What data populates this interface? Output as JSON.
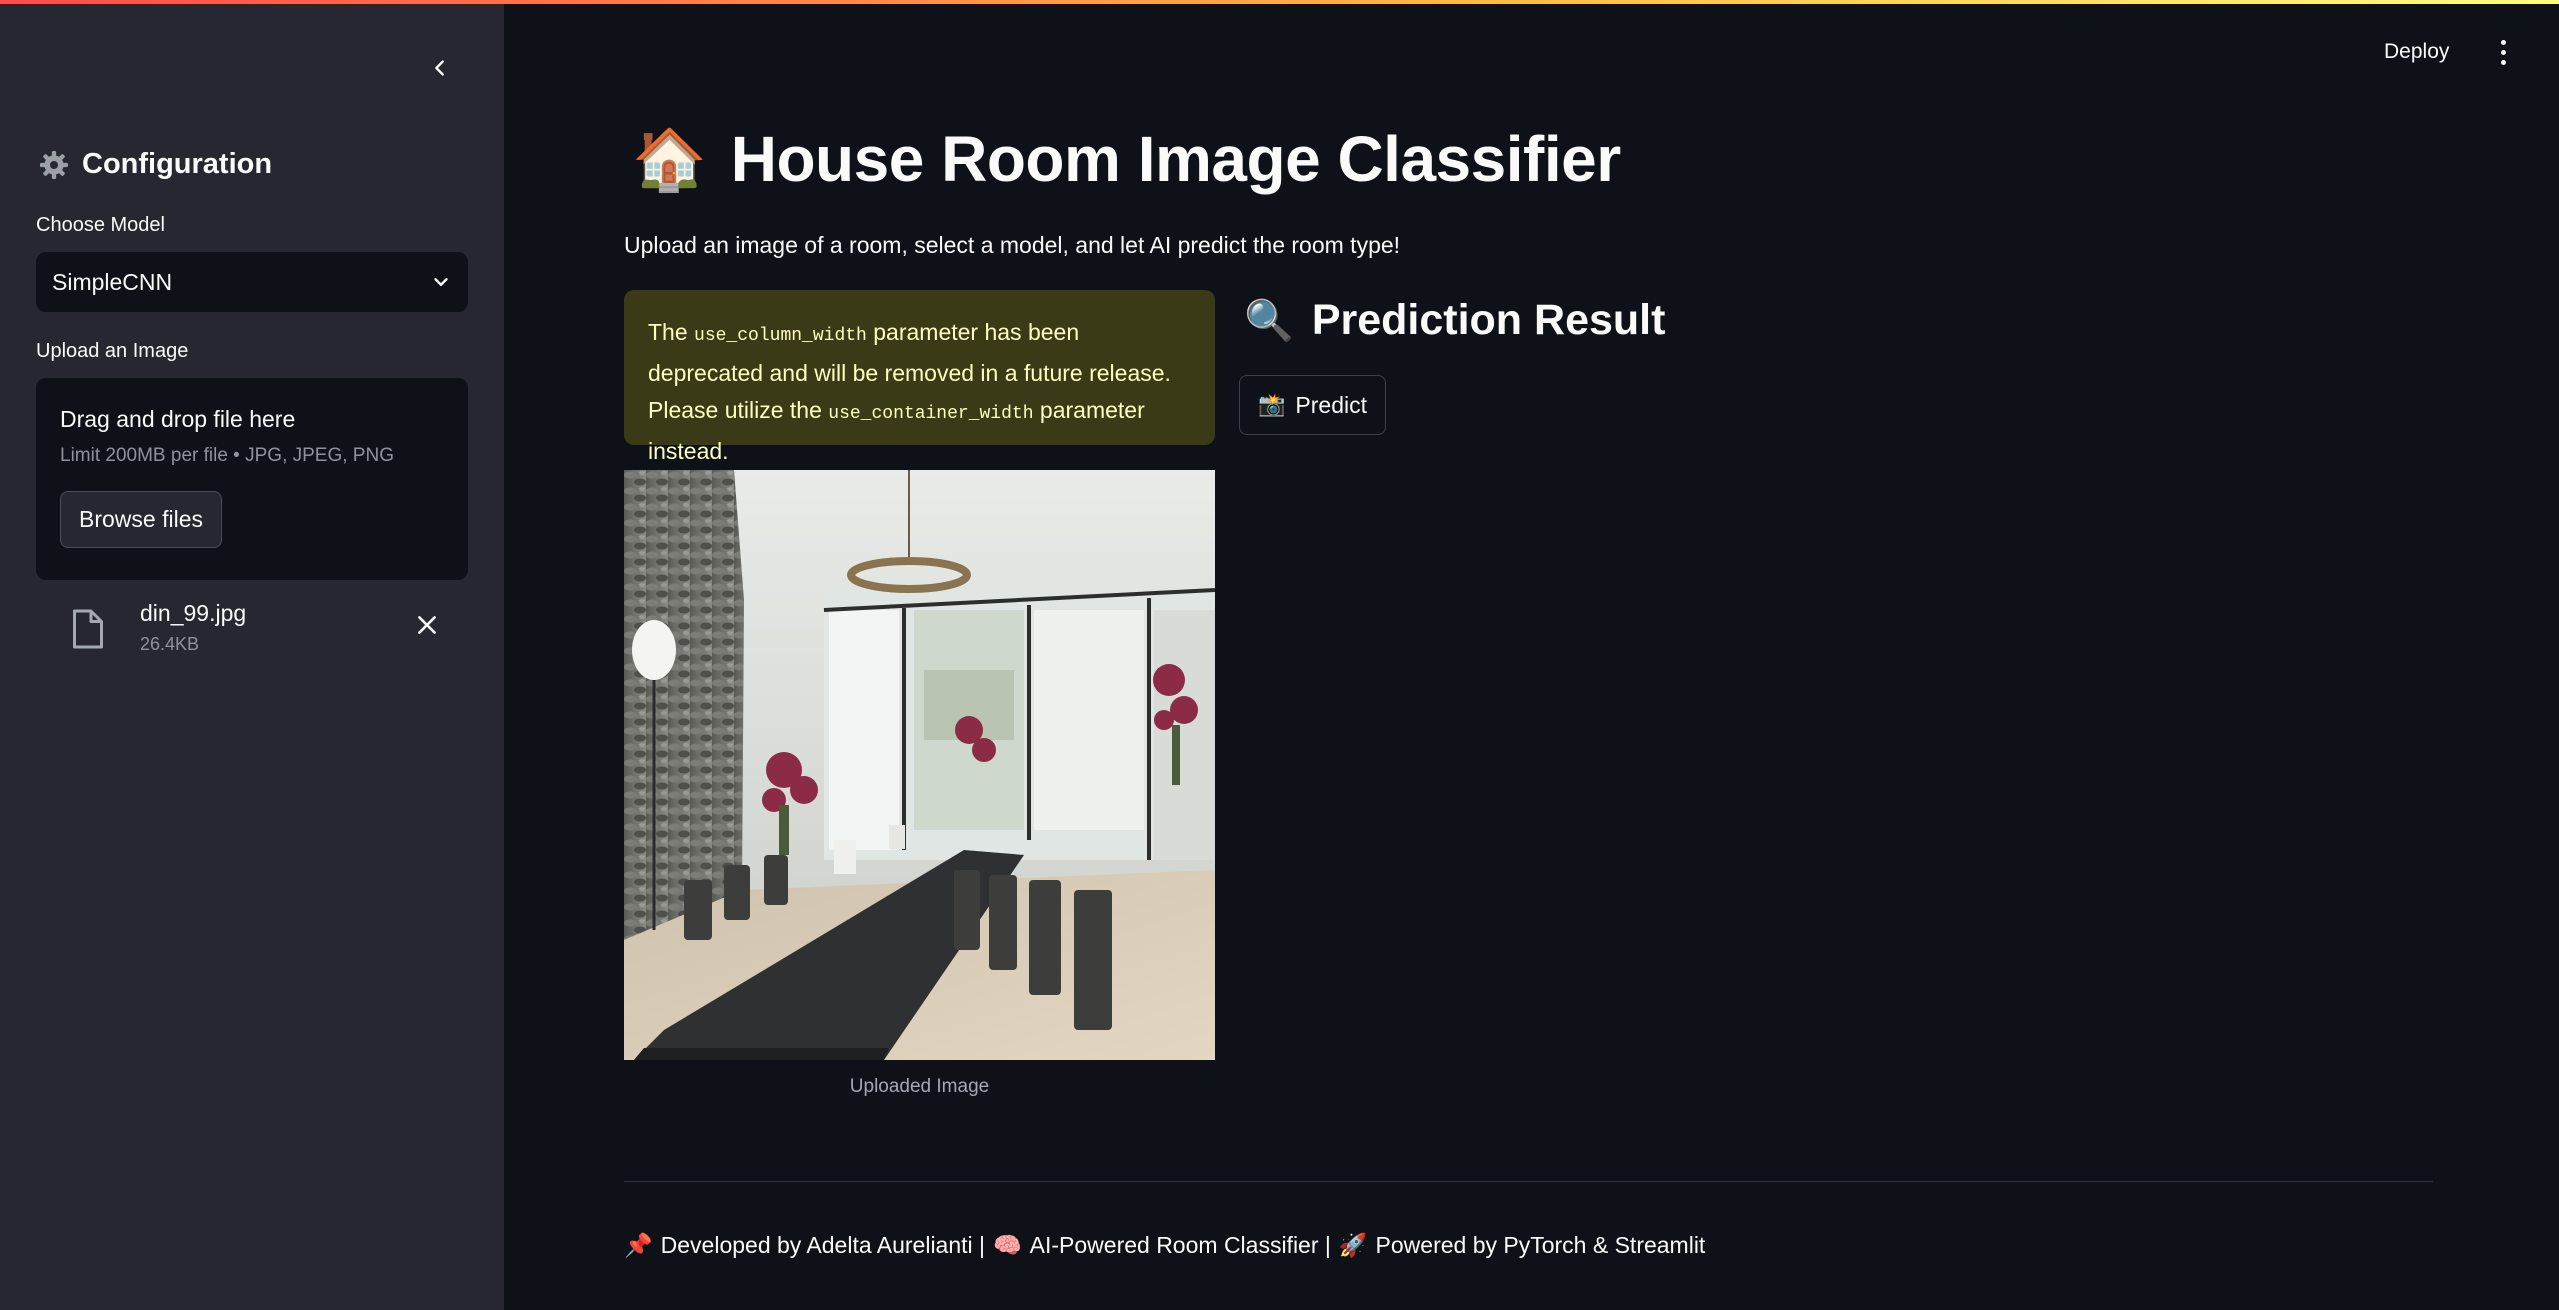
{
  "sidebar": {
    "title": "Configuration",
    "title_icon": "gear-icon",
    "model_label": "Choose Model",
    "model_selected": "SimpleCNN",
    "upload_label": "Upload an Image",
    "dropzone_title": "Drag and drop file here",
    "dropzone_limit": "Limit 200MB per file • JPG, JPEG, PNG",
    "browse_label": "Browse files",
    "file": {
      "name": "din_99.jpg",
      "size": "26.4KB"
    }
  },
  "header": {
    "deploy_label": "Deploy"
  },
  "main": {
    "title_emoji": "🏠",
    "title": "House Room Image Classifier",
    "subtitle": "Upload an image of a room, select a model, and let AI predict the room type!",
    "warning": {
      "part1": "The ",
      "code1": "use_column_width",
      "part2": " parameter has been deprecated and will be removed in a future release. Please utilize the ",
      "code2": "use_container_width",
      "part3": " parameter instead."
    },
    "prediction_emoji": "🔍",
    "prediction_title": "Prediction Result",
    "predict_emoji": "📸",
    "predict_label": "Predict",
    "image_caption": "Uploaded Image"
  },
  "footer": {
    "pin": "📌",
    "developed": "Developed by Adelta Aurelianti |",
    "brain": "🧠",
    "classifier": "AI-Powered Room Classifier |",
    "rocket": "🚀",
    "powered": "Powered by PyTorch & Streamlit"
  },
  "colors": {
    "background": "#0e1117",
    "sidebar": "#262730",
    "accent": "#ff4b4b",
    "warning_bg": "#3b3a16",
    "warning_text": "#ffffc2"
  }
}
